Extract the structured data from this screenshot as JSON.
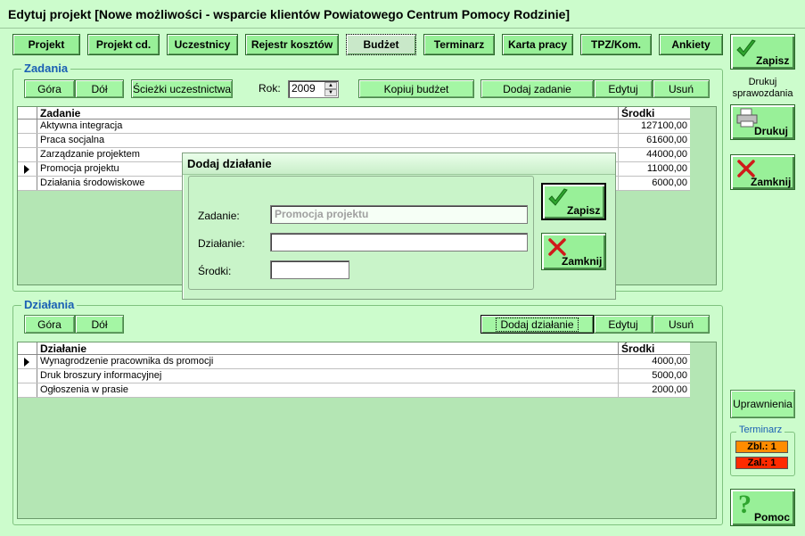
{
  "window": {
    "title": "Edytuj projekt  [Nowe możliwości - wsparcie klientów Powiatowego Centrum Pomocy Rodzinie]"
  },
  "tabs": [
    {
      "label": "Projekt"
    },
    {
      "label": "Projekt cd."
    },
    {
      "label": "Uczestnicy"
    },
    {
      "label": "Rejestr kosztów"
    },
    {
      "label": "Budżet"
    },
    {
      "label": "Terminarz"
    },
    {
      "label": "Karta pracy"
    },
    {
      "label": "TPZ/Kom."
    },
    {
      "label": "Ankiety"
    }
  ],
  "zadania": {
    "legend": "Zadania",
    "buttons": {
      "up": "Góra",
      "down": "Dół",
      "paths": "Ścieżki uczestnictwa",
      "copy": "Kopiuj budżet",
      "add": "Dodaj zadanie",
      "edit": "Edytuj",
      "delete": "Usuń"
    },
    "year_label": "Rok:",
    "year_value": "2009",
    "columns": {
      "name": "Zadanie",
      "amount": "Środki"
    },
    "rows": [
      {
        "name": "Aktywna integracja",
        "amount": "127100,00"
      },
      {
        "name": "Praca socjalna",
        "amount": "61600,00"
      },
      {
        "name": "Zarządzanie projektem",
        "amount": "44000,00"
      },
      {
        "name": "Promocja projektu",
        "amount": "11000,00"
      },
      {
        "name": "Działania środowiskowe",
        "amount": "6000,00"
      }
    ]
  },
  "dzialania": {
    "legend": "Działania",
    "buttons": {
      "up": "Góra",
      "down": "Dół",
      "add": "Dodaj działanie",
      "edit": "Edytuj",
      "delete": "Usuń"
    },
    "columns": {
      "name": "Działanie",
      "amount": "Środki"
    },
    "rows": [
      {
        "name": "Wynagrodzenie pracownika ds promocji",
        "amount": "4000,00"
      },
      {
        "name": "Druk broszury informacyjnej",
        "amount": "5000,00"
      },
      {
        "name": "Ogłoszenia w prasie",
        "amount": "2000,00"
      }
    ]
  },
  "sidebar": {
    "save": "Zapisz",
    "print_label": "Drukuj sprawozdania",
    "print": "Drukuj",
    "close": "Zamknij",
    "permissions": "Uprawnienia",
    "terminarz_legend": "Terminarz",
    "zbl": "Zbl.: 1",
    "zal": "Zal.: 1",
    "help": "Pomoc"
  },
  "dialog": {
    "title": "Dodaj działanie",
    "task_label": "Zadanie:",
    "task_value": "Promocja projektu",
    "action_label": "Działanie:",
    "action_value": "",
    "funds_label": "Środki:",
    "funds_value": "",
    "save": "Zapisz",
    "close": "Zamknij"
  },
  "colors": {
    "background": "#ccfccc",
    "button": "#98f098",
    "legend": "#1a5fb4",
    "check": "#2fa52f",
    "cross": "#d01a1a",
    "zbl": "#ff8c00",
    "zal": "#ff2a00"
  }
}
